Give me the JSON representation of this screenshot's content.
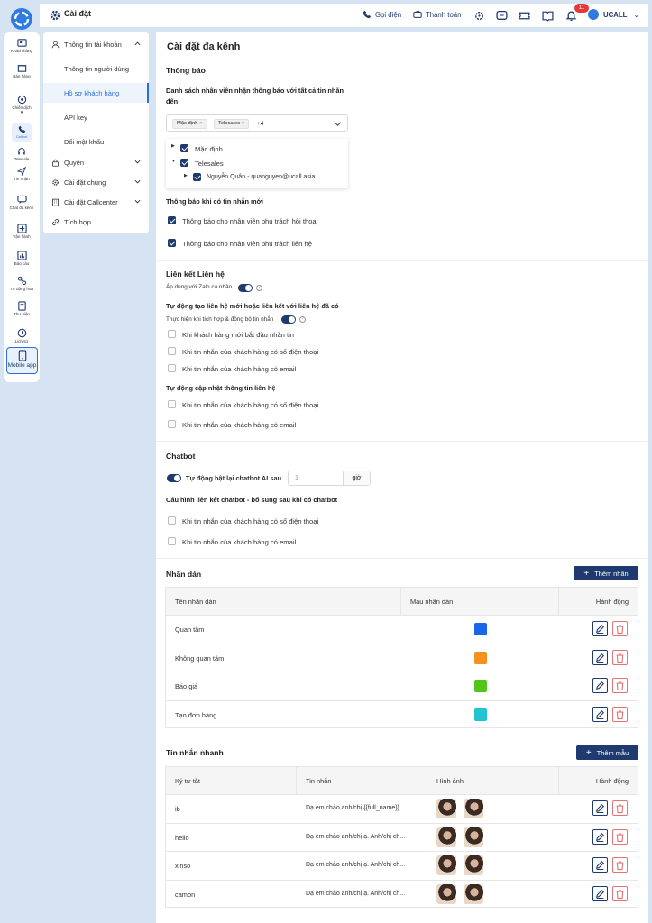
{
  "rail": {
    "items": [
      "Khách hàng",
      "Bán hàng",
      "Chiến dịch",
      "Callbot",
      "Telesale",
      "Tin nhận",
      "Chat đa kênh",
      "Vận hành",
      "Báo cáo",
      "Tự động hoá",
      "Thư viện",
      "Lịch sử",
      "Mobile app"
    ]
  },
  "topbar": {
    "title": "Cài đặt",
    "call": "Gọi điện",
    "pay": "Thanh toán",
    "notif_count": "11",
    "user": "UCALL"
  },
  "nav": {
    "account": "Thông tin tài khoản",
    "user_info": "Thông tin người dùng",
    "customer_profile": "Hồ sơ khách hàng",
    "api_key": "API key",
    "change_password": "Đổi mật khẩu",
    "permissions": "Quyền",
    "general": "Cài đặt chung",
    "callcenter": "Cài đặt Callcenter",
    "integration": "Tích hợp"
  },
  "main": {
    "title": "Cài đặt đa kênh",
    "notify": {
      "heading": "Thông báo",
      "staff_label": "Danh sách nhân viên nhận thông báo với tất cả tin nhắn đến",
      "tags": [
        "Mặc định",
        "Telesales"
      ],
      "more": "+4",
      "tree": [
        "Mặc định",
        "Telesales",
        "Nguyễn Quân - quanguyen@ucall.asia"
      ],
      "new_msg_label": "Thông báo khi có tin nhắn mới",
      "opt1": "Thông báo cho nhân viên phụ trách hội thoại",
      "opt2": "Thông báo cho nhân viên phụ trách liên hệ"
    },
    "link": {
      "heading": "Liên kết Liên hệ",
      "zalo": "Áp dụng với Zalo cá nhân",
      "auto_create": "Tự động tạo liên hệ mới hoặc liên kết với liên hệ đã có",
      "sync": "Thực hiện khi tích hợp & đồng bộ tin nhắn",
      "c1": "Khi khách hàng mới bắt đầu nhắn tin",
      "c2": "Khi tin nhắn của khách hàng có số điện thoại",
      "c3": "Khi tin nhắn của khách hàng có email",
      "auto_update": "Tự động cập nhật thông tin liên hệ",
      "u1": "Khi tin nhắn của khách hàng có số điện thoại",
      "u2": "Khi tin nhắn của khách hàng có email"
    },
    "chatbot": {
      "heading": "Chatbot",
      "reenable": "Tự động bật lại chatbot AI sau",
      "hours_value": "1",
      "hours_unit": "giờ",
      "config_label": "Cấu hình liên kết chatbot - bổ sung sau khi có chatbot",
      "k1": "Khi tin nhắn của khách hàng có số điện thoại",
      "k2": "Khi tin nhắn của khách hàng có email"
    },
    "labels": {
      "heading": "Nhãn dán",
      "add": "Thêm nhãn",
      "cols": [
        "Tên nhãn dán",
        "Màu nhãn dán",
        "Hành động"
      ],
      "rows": [
        {
          "name": "Quan tâm",
          "color": "#1a66e8"
        },
        {
          "name": "Không quan tâm",
          "color": "#f5911e"
        },
        {
          "name": "Báo giá",
          "color": "#52c41a"
        },
        {
          "name": "Tạo đơn hàng",
          "color": "#22c3d0"
        }
      ]
    },
    "quick": {
      "heading": "Tin nhắn nhanh",
      "add": "Thêm mẫu",
      "cols": [
        "Ký tự tắt",
        "Tin nhắn",
        "Hình ảnh",
        "Hành động"
      ],
      "rows": [
        {
          "key": "ib",
          "msg": "Dạ em chào anh/chị {{full_name}}..."
        },
        {
          "key": "hello",
          "msg": "Dạ em chào anh/chị ạ. Anh/chị ch..."
        },
        {
          "key": "xinso",
          "msg": "Dạ em chào anh/chị ạ. Anh/chị ch..."
        },
        {
          "key": "camon",
          "msg": "Dạ em chào anh/chị ạ. Anh/chị ch..."
        }
      ]
    }
  }
}
